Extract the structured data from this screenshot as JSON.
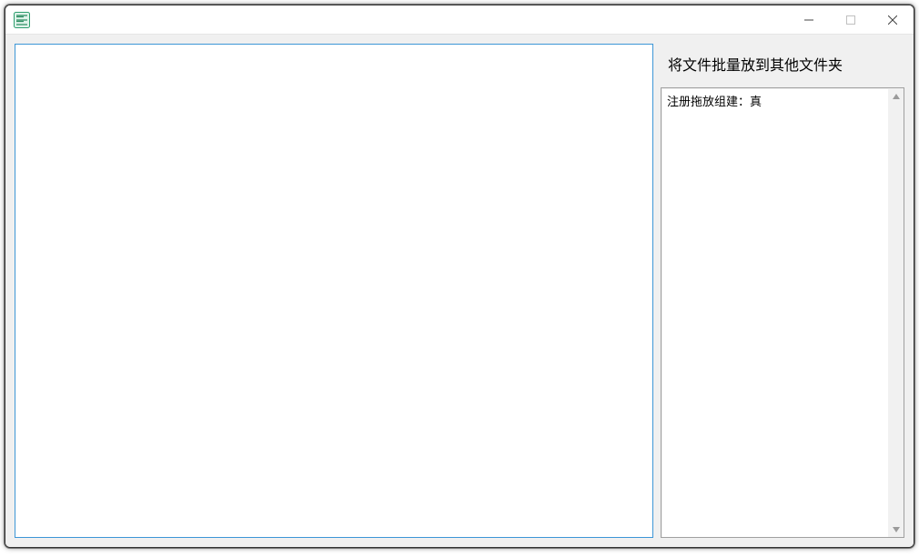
{
  "window": {
    "title": ""
  },
  "right": {
    "heading": "将文件批量放到其他文件夹",
    "log_lines": [
      "注册拖放组建：真"
    ]
  },
  "left": {
    "textarea_value": "",
    "textarea_placeholder": ""
  }
}
